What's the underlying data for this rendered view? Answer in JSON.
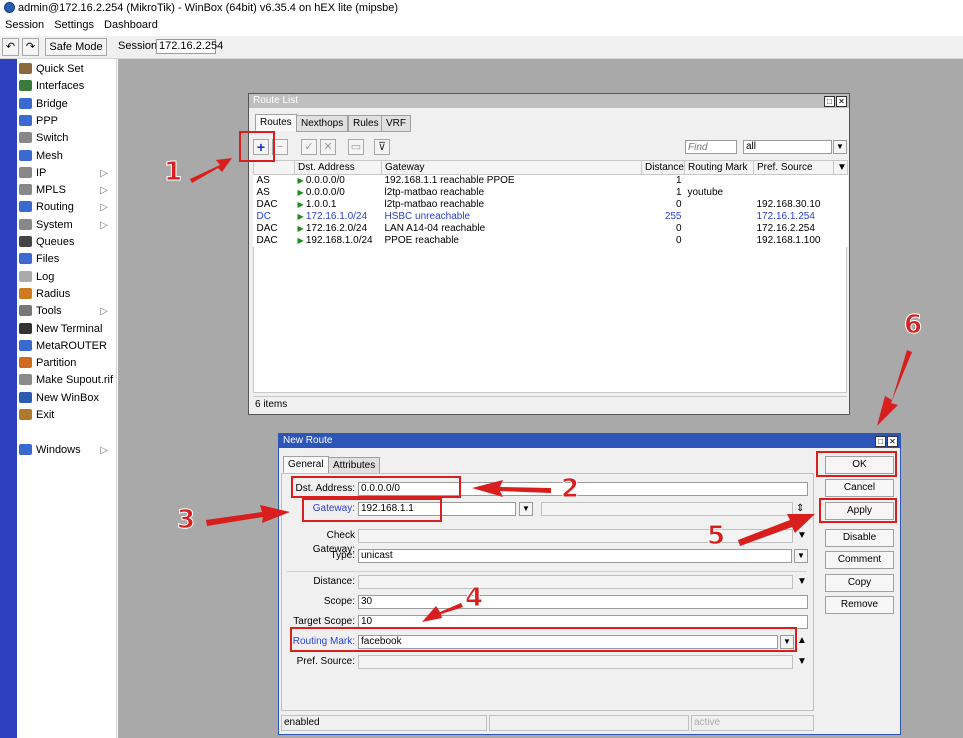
{
  "app": {
    "title": "admin@172.16.2.254 (MikroTik) - WinBox (64bit) v6.35.4 on hEX lite (mipsbe)",
    "menu": [
      "Session",
      "Settings",
      "Dashboard"
    ],
    "toolbar": {
      "undo": "↶",
      "redo": "↷",
      "safe_mode": "Safe Mode",
      "session_label": "Session:",
      "session_value": "172.16.2.254"
    }
  },
  "sidebar": {
    "items": [
      {
        "label": "Quick Set",
        "icon": "wand-icon",
        "color": "#8a6a3a",
        "submenu": false
      },
      {
        "label": "Interfaces",
        "icon": "interfaces-icon",
        "color": "#3a7a3a",
        "submenu": false
      },
      {
        "label": "Bridge",
        "icon": "bridge-icon",
        "color": "#3a6ad0",
        "submenu": false
      },
      {
        "label": "PPP",
        "icon": "ppp-icon",
        "color": "#3a6ad0",
        "submenu": false
      },
      {
        "label": "Switch",
        "icon": "switch-icon",
        "color": "#888888",
        "submenu": false
      },
      {
        "label": "Mesh",
        "icon": "mesh-icon",
        "color": "#3a6ad0",
        "submenu": false
      },
      {
        "label": "IP",
        "icon": "ip-icon",
        "color": "#888888",
        "submenu": true
      },
      {
        "label": "MPLS",
        "icon": "mpls-icon",
        "color": "#888888",
        "submenu": true
      },
      {
        "label": "Routing",
        "icon": "routing-icon",
        "color": "#3a6ad0",
        "submenu": true
      },
      {
        "label": "System",
        "icon": "gear-icon",
        "color": "#888888",
        "submenu": true
      },
      {
        "label": "Queues",
        "icon": "queues-icon",
        "color": "#444444",
        "submenu": false
      },
      {
        "label": "Files",
        "icon": "folder-icon",
        "color": "#3a6ad0",
        "submenu": false
      },
      {
        "label": "Log",
        "icon": "log-icon",
        "color": "#aaaaaa",
        "submenu": false
      },
      {
        "label": "Radius",
        "icon": "radius-icon",
        "color": "#d07a20",
        "submenu": false
      },
      {
        "label": "Tools",
        "icon": "tools-icon",
        "color": "#777777",
        "submenu": true
      },
      {
        "label": "New Terminal",
        "icon": "terminal-icon",
        "color": "#333333",
        "submenu": false
      },
      {
        "label": "MetaROUTER",
        "icon": "metarouter-icon",
        "color": "#3a6ad0",
        "submenu": false
      },
      {
        "label": "Partition",
        "icon": "partition-icon",
        "color": "#d06a20",
        "submenu": false
      },
      {
        "label": "Make Supout.rif",
        "icon": "document-icon",
        "color": "#8a8a8a",
        "submenu": false
      },
      {
        "label": "New WinBox",
        "icon": "winbox-icon",
        "color": "#2a5db0",
        "submenu": false
      },
      {
        "label": "Exit",
        "icon": "exit-icon",
        "color": "#b07a2a",
        "submenu": false
      },
      {
        "label": "Windows",
        "icon": "windows-icon",
        "color": "#3a6ad0",
        "submenu": true
      }
    ]
  },
  "route_list": {
    "title": "Route List",
    "tabs": [
      "Routes",
      "Nexthops",
      "Rules",
      "VRF"
    ],
    "find_placeholder": "Find",
    "filter_value": "all",
    "columns": [
      "",
      "Dst. Address",
      "Gateway",
      "Distance",
      "Routing Mark",
      "Pref. Source"
    ],
    "rows": [
      {
        "flags": "AS",
        "dst": "0.0.0.0/0",
        "gateway": "192.168.1.1 reachable PPOE",
        "distance": "1",
        "mark": "",
        "pref": "",
        "blue": false
      },
      {
        "flags": "AS",
        "dst": "0.0.0.0/0",
        "gateway": "l2tp-matbao reachable",
        "distance": "1",
        "mark": "youtube",
        "pref": "",
        "blue": false
      },
      {
        "flags": "DAC",
        "dst": "1.0.0.1",
        "gateway": "l2tp-matbao reachable",
        "distance": "0",
        "mark": "",
        "pref": "192.168.30.10",
        "blue": false
      },
      {
        "flags": "DC",
        "dst": "172.16.1.0/24",
        "gateway": "HSBC unreachable",
        "distance": "255",
        "mark": "",
        "pref": "172.16.1.254",
        "blue": true
      },
      {
        "flags": "DAC",
        "dst": "172.16.2.0/24",
        "gateway": "LAN A14-04 reachable",
        "distance": "0",
        "mark": "",
        "pref": "172.16.2.254",
        "blue": false
      },
      {
        "flags": "DAC",
        "dst": "192.168.1.0/24",
        "gateway": "PPOE reachable",
        "distance": "0",
        "mark": "",
        "pref": "192.168.1.100",
        "blue": false
      }
    ],
    "status": "6 items"
  },
  "new_route": {
    "title": "New Route",
    "tabs": [
      "General",
      "Attributes"
    ],
    "fields": {
      "dst_label": "Dst. Address:",
      "dst_value": "0.0.0.0/0",
      "gw_label": "Gateway:",
      "gw_value": "192.168.1.1",
      "check_label": "Check Gateway:",
      "type_label": "Type:",
      "type_value": "unicast",
      "distance_label": "Distance:",
      "scope_label": "Scope:",
      "scope_value": "30",
      "target_label": "Target Scope:",
      "target_value": "10",
      "mark_label": "Routing Mark:",
      "mark_value": "facebook",
      "pref_label": "Pref. Source:"
    },
    "buttons": [
      "OK",
      "Cancel",
      "Apply",
      "Disable",
      "Comment",
      "Copy",
      "Remove"
    ],
    "status_left": "enabled",
    "status_right": "active"
  },
  "annotations": [
    "1",
    "2",
    "3",
    "4",
    "5",
    "6"
  ],
  "colors": {
    "highlight": "#d91e1e",
    "title_active": "#2d55b8",
    "strip": "#2b3fbf"
  }
}
